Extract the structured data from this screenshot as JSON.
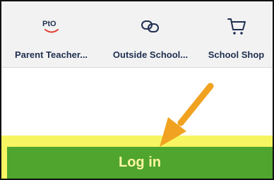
{
  "nav": {
    "items": [
      {
        "label": "Parent Teacher...",
        "icon": "pto-logo-icon",
        "logo_text": "PtO"
      },
      {
        "label": "Outside School...",
        "icon": "link-icon"
      },
      {
        "label": "School Shop",
        "icon": "shopping-cart-icon"
      }
    ]
  },
  "login": {
    "label": "Log in"
  },
  "colors": {
    "nav_text": "#1f2f50",
    "button_bg": "#4fa52e",
    "button_text": "#fff5a3",
    "highlight": "#f7f562",
    "arrow": "#f0a220"
  }
}
